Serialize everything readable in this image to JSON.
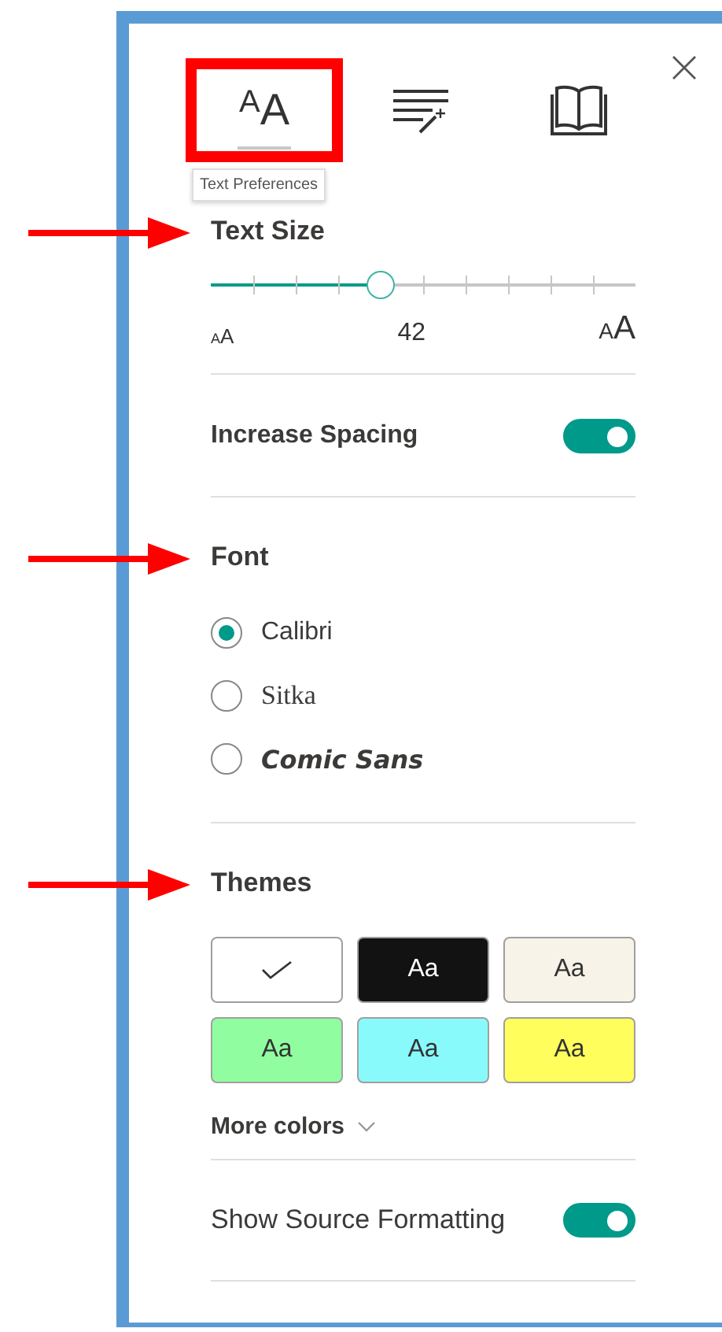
{
  "tabs": [
    {
      "kind": "text",
      "small": "A",
      "large": "A",
      "selected": true,
      "highlighted": true
    },
    {
      "kind": "lines",
      "selected": false,
      "highlighted": false
    },
    {
      "kind": "book",
      "selected": false,
      "highlighted": false
    }
  ],
  "tooltip": "Text Preferences",
  "text_size": {
    "heading": "Text Size",
    "arrow": true,
    "level": 0.4,
    "reading": "42",
    "small": {
      "small": "A",
      "large": "A"
    },
    "large": {
      "small": "A",
      "large": "A"
    }
  },
  "spacing": {
    "label": "Increase Spacing",
    "on": true
  },
  "font": {
    "heading": "Font",
    "arrow": true,
    "options": [
      {
        "label": "Calibri",
        "kind": "sans",
        "selected": true
      },
      {
        "label": "Sitka",
        "kind": "serif",
        "selected": false
      },
      {
        "label": "Comic Sans",
        "kind": "comic",
        "selected": false
      }
    ]
  },
  "themes": {
    "heading": "Themes",
    "arrow": true,
    "swatches": [
      {
        "color": "#ffffff",
        "selected": true
      },
      {
        "label": "Aa",
        "color": "#121212",
        "selected": false
      },
      {
        "label": "Aa",
        "color": "#f7f3e8",
        "selected": false
      },
      {
        "label": "Aa",
        "color": "#90fea0",
        "selected": false
      },
      {
        "label": "Aa",
        "color": "#88fafc",
        "selected": false
      },
      {
        "label": "Aa",
        "color": "#fffe5c",
        "selected": false
      }
    ],
    "more": "More colors"
  },
  "source_formatting": {
    "label": "Show Source Formatting",
    "on": true
  }
}
